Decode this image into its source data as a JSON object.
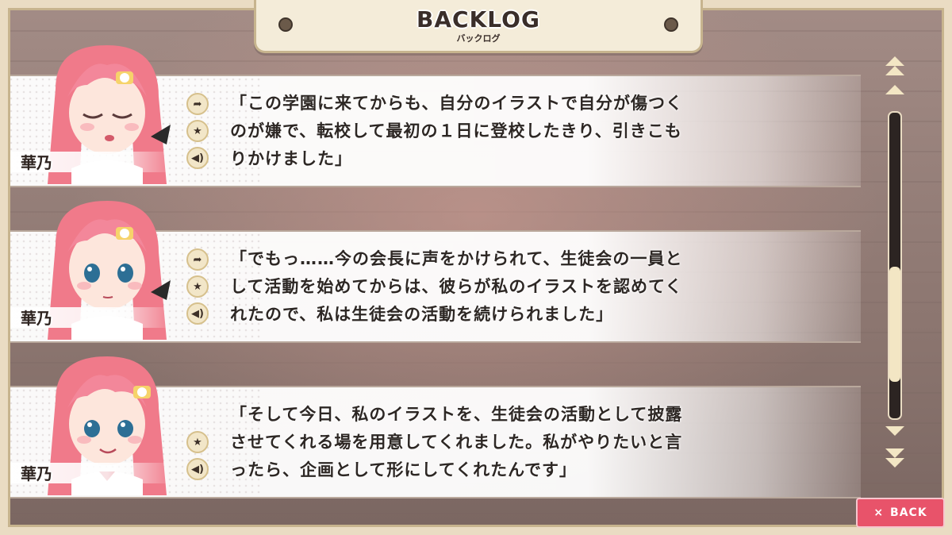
{
  "header": {
    "title": "BACKLOG",
    "subtitle": "バックログ"
  },
  "entries": [
    {
      "speaker": "華乃",
      "lines": [
        "「この学園に来てからも、自分のイラストで自分が傷つく",
        "のが嫌で、転校して最初の１日に登校したきり、引きこも",
        "りかけました」"
      ],
      "expression": "eyes-closed-sad",
      "has_jump": true
    },
    {
      "speaker": "華乃",
      "lines": [
        "「でもっ……今の会長に声をかけられて、生徒会の一員と",
        "して活動を始めてからは、彼らが私のイラストを認めてく",
        "れたので、私は生徒会の活動を続けられました」"
      ],
      "expression": "eyes-open-serious",
      "has_jump": true
    },
    {
      "speaker": "華乃",
      "lines": [
        "「そして今日、私のイラストを、生徒会の活動として披露",
        "させてくれる場を用意してくれました。私がやりたいと言",
        "ったら、企画として形にしてくれたんです」"
      ],
      "expression": "smile",
      "has_jump": false
    }
  ],
  "scrollbar": {
    "position": 0.82,
    "thumb_fraction": 0.38
  },
  "back_button": {
    "icon": "×",
    "label": "BACK"
  },
  "icons": {
    "jump": "jump-icon",
    "favorite": "star-icon",
    "voice": "voice-replay-icon"
  },
  "colors": {
    "frame": "#eadcc3",
    "back_button": "#e8536a",
    "hair": "#f07a8a",
    "ribbon": "#f6d36a"
  }
}
